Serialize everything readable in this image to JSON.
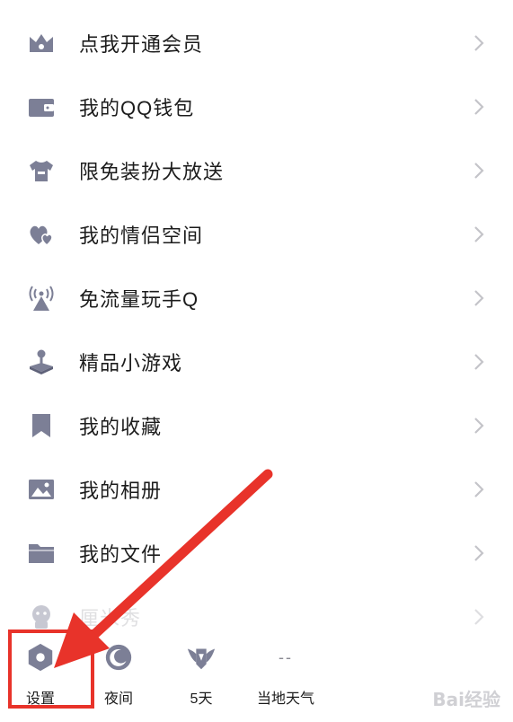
{
  "menu": {
    "items": [
      {
        "label": "点我开通会员",
        "icon": "crown-icon"
      },
      {
        "label": "我的QQ钱包",
        "icon": "wallet-icon"
      },
      {
        "label": "限免装扮大放送",
        "icon": "shirt-icon"
      },
      {
        "label": "我的情侣空间",
        "icon": "hearts-icon"
      },
      {
        "label": "免流量玩手Q",
        "icon": "signal-tower-icon"
      },
      {
        "label": "精品小游戏",
        "icon": "joystick-icon"
      },
      {
        "label": "我的收藏",
        "icon": "bookmark-icon"
      },
      {
        "label": "我的相册",
        "icon": "photo-icon"
      },
      {
        "label": "我的文件",
        "icon": "folder-icon"
      },
      {
        "label": "厘米秀",
        "icon": "character-icon"
      }
    ]
  },
  "toolbar": {
    "settings_label": "设置",
    "night_label": "夜间",
    "days_label": "5天",
    "weather_label": "当地天气",
    "weather_placeholder": "--"
  },
  "watermark": "Bai经验",
  "colors": {
    "icon": "#7c7f96",
    "chevron": "#c4c4c9",
    "highlight": "#e8332a"
  }
}
